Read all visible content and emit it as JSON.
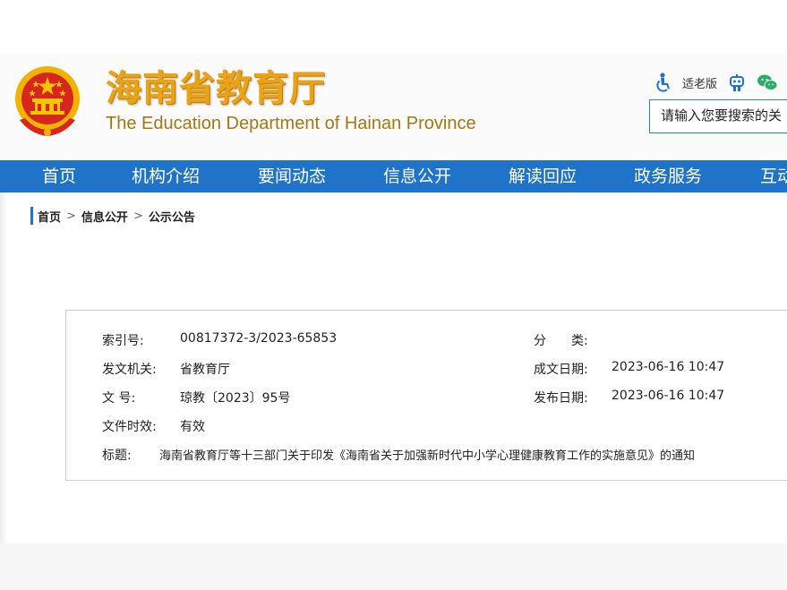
{
  "header": {
    "title": "海南省教育厅",
    "subtitle": "The Education Department of Hainan Province",
    "elder_mode_label": "适老版",
    "search_placeholder": "请输入您要搜索的关"
  },
  "nav": {
    "items": [
      {
        "label": "首页"
      },
      {
        "label": "机构介绍"
      },
      {
        "label": "要闻动态"
      },
      {
        "label": "信息公开"
      },
      {
        "label": "解读回应"
      },
      {
        "label": "政务服务"
      },
      {
        "label": "互动"
      }
    ]
  },
  "breadcrumb": {
    "items": [
      "首页",
      "信息公开",
      "公示公告"
    ],
    "separator": ">"
  },
  "doc_info": {
    "index_label": "索引号:",
    "index_value": "00817372-3/2023-65853",
    "category_label": "分　　类:",
    "category_value": "",
    "issuer_label": "发文机关:",
    "issuer_value": "省教育厅",
    "written_label": "成文日期:",
    "written_value": "2023-06-16 10:47",
    "docno_label": "文 号:",
    "docno_value": "琼教〔2023〕95号",
    "published_label": "发布日期:",
    "published_value": "2023-06-16 10:47",
    "validity_label": "文件时效:",
    "validity_value": "有效",
    "title_label": "标题:",
    "title_value": "海南省教育厅等十三部门关于印发《海南省关于加强新时代中小学心理健康教育工作的实施意见》的通知"
  },
  "colors": {
    "brand_blue": "#1f73c8",
    "title_gold": "#e8a317",
    "emblem_red": "#d7261e",
    "emblem_gold": "#f0b400"
  }
}
